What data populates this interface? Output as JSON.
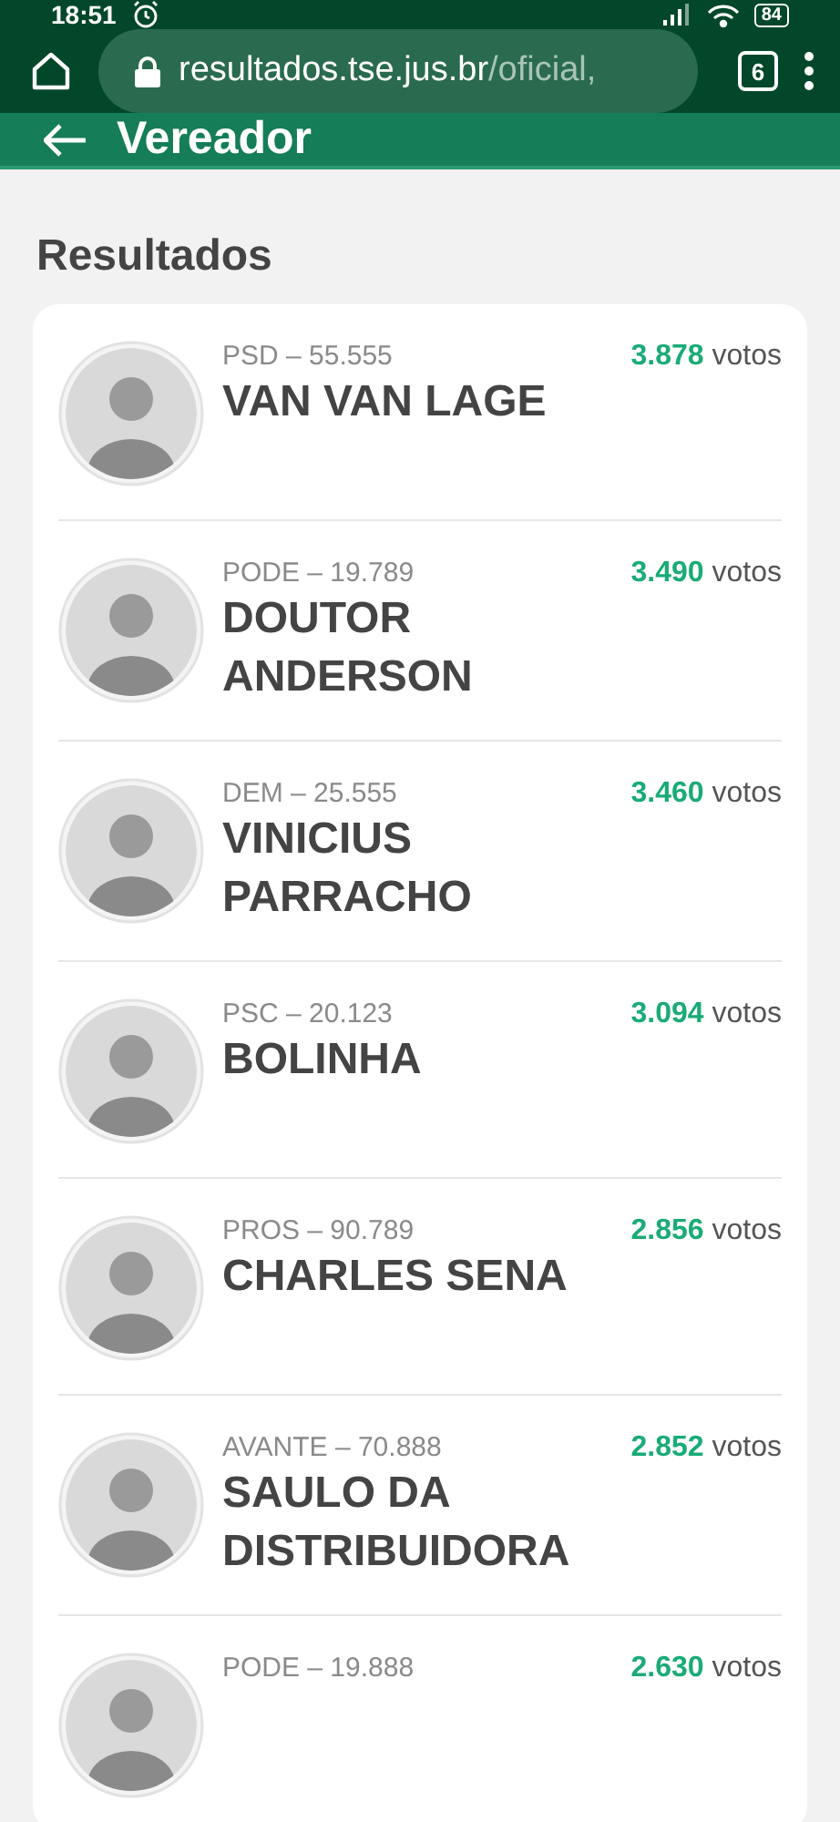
{
  "status_bar": {
    "time": "18:51",
    "battery": "84"
  },
  "browser": {
    "url_host": "resultados.tse.jus.br",
    "url_path": "/oficial,",
    "tab_count": "6"
  },
  "header": {
    "title": "Vereador"
  },
  "section_title": "Resultados",
  "candidates": [
    {
      "party": "PSD – 55.555",
      "name": "VAN VAN LAGE",
      "votes": "3.878",
      "votes_unit": "votos"
    },
    {
      "party": "PODE – 19.789",
      "name": "DOUTOR ANDERSON",
      "votes": "3.490",
      "votes_unit": "votos"
    },
    {
      "party": "DEM – 25.555",
      "name": "VINICIUS PARRACHO",
      "votes": "3.460",
      "votes_unit": "votos"
    },
    {
      "party": "PSC – 20.123",
      "name": "BOLINHA",
      "votes": "3.094",
      "votes_unit": "votos"
    },
    {
      "party": "PROS – 90.789",
      "name": "CHARLES SENA",
      "votes": "2.856",
      "votes_unit": "votos"
    },
    {
      "party": "AVANTE – 70.888",
      "name": "SAULO DA DISTRIBUIDORA",
      "votes": "2.852",
      "votes_unit": "votos"
    },
    {
      "party": "PODE – 19.888",
      "votes": "2.630",
      "votes_unit": "votos"
    }
  ]
}
